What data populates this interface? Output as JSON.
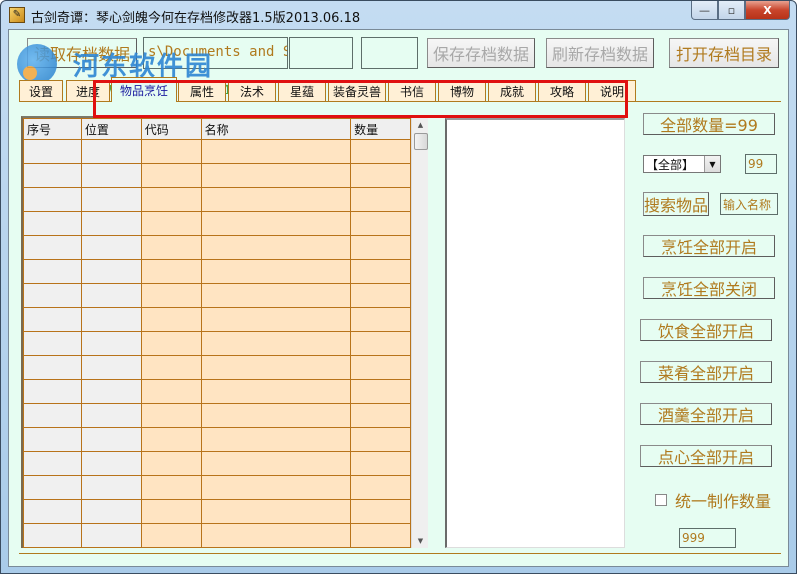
{
  "window": {
    "title": "古剑奇谭：琴心剑魄今何在存档修改器1.5版2013.06.18",
    "app_icon_glyph": "✎",
    "controls": {
      "minimize": "—",
      "maximize": "▫",
      "close": "X"
    }
  },
  "watermark": {
    "text": "河东软件园",
    "url": "www.pc0359.cn"
  },
  "toolbar": {
    "read_button": "读取存档数据",
    "path_field": "s\\Documents and S",
    "field2": "",
    "field3": "",
    "save_button": "保存存档数据",
    "refresh_button": "刷新存档数据",
    "open_dir_button": "打开存档目录"
  },
  "tabs": [
    {
      "label": "设置",
      "active": false
    },
    {
      "label": "进度",
      "active": false
    },
    {
      "label": "物品烹饪",
      "active": true
    },
    {
      "label": "属性",
      "active": false
    },
    {
      "label": "法术",
      "active": false
    },
    {
      "label": "星蕴",
      "active": false
    },
    {
      "label": "装备灵兽",
      "active": false
    },
    {
      "label": "书信",
      "active": false
    },
    {
      "label": "博物",
      "active": false
    },
    {
      "label": "成就",
      "active": false
    },
    {
      "label": "攻略",
      "active": false
    },
    {
      "label": "说明",
      "active": false
    }
  ],
  "grid": {
    "columns": [
      "序号",
      "位置",
      "代码",
      "名称",
      "数量"
    ],
    "row_count": 17,
    "rows": []
  },
  "scrollbar": {
    "up": "▲",
    "down": "▼"
  },
  "side_panel": {
    "total_button": "全部数量=99",
    "category_select": "【全部】",
    "category_arrow": "▼",
    "count_field": "99",
    "search_button": "搜索物品",
    "name_input": "输入名称",
    "cook_all_on": "烹饪全部开启",
    "cook_all_off": "烹饪全部关闭",
    "food_all_on": "饮食全部开启",
    "dish_all_on": "菜肴全部开启",
    "soup_all_on": "酒羹全部开启",
    "dessert_all_on": "点心全部开启",
    "unify_checkbox_label": "统一制作数量",
    "unify_checked": false,
    "unify_qty_field": "999"
  },
  "colors": {
    "client_bg": "#e6fdf2",
    "accent_text": "#b07a1e",
    "grid_border": "#b8731a",
    "cell_bg": "#ffe4c2",
    "highlight": "#e01010"
  }
}
